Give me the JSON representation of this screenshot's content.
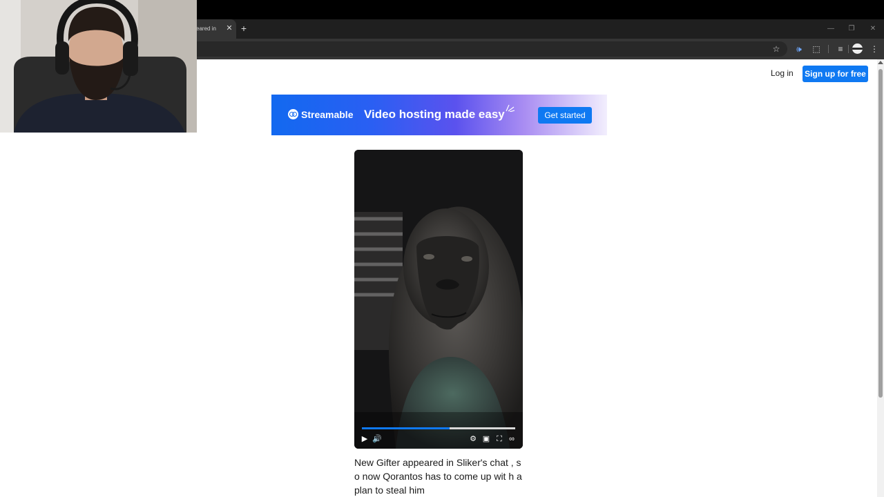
{
  "browser": {
    "tab": {
      "title": "eared in",
      "close_glyph": "✕"
    },
    "new_tab_glyph": "+",
    "window_controls": {
      "minimize": "—",
      "restore": "❐",
      "close": "✕"
    },
    "toolbar_icons": [
      "bookmark-star-icon",
      "speaker-icon",
      "extensions-icon",
      "media-queue-icon",
      "profile-avatar",
      "menu-kebab-icon"
    ],
    "icon_glyphs": {
      "star": "☆",
      "speaker": "🕪",
      "extension": "⬚",
      "media": "≡",
      "kebab": "⋮"
    }
  },
  "header": {
    "login_label": "Log in",
    "signup_label": "Sign up for free"
  },
  "banner": {
    "brand": "Streamable",
    "tagline": "Video hosting made easy",
    "cta": "Get started"
  },
  "video": {
    "progress_fraction": 0.57,
    "controls": {
      "play": "▶",
      "volume": "🔊",
      "settings": "⚙",
      "pip": "▣",
      "fullscreen": "⛶",
      "brand": "∞"
    }
  },
  "caption": {
    "text": "New Gifter appeared in Sliker's chat , so now Qorantos has to come up wit h a plan to steal him"
  },
  "colors": {
    "accent": "#0f79f2",
    "page_bg": "#ffffff",
    "chrome_dark": "#1f1f1f"
  }
}
